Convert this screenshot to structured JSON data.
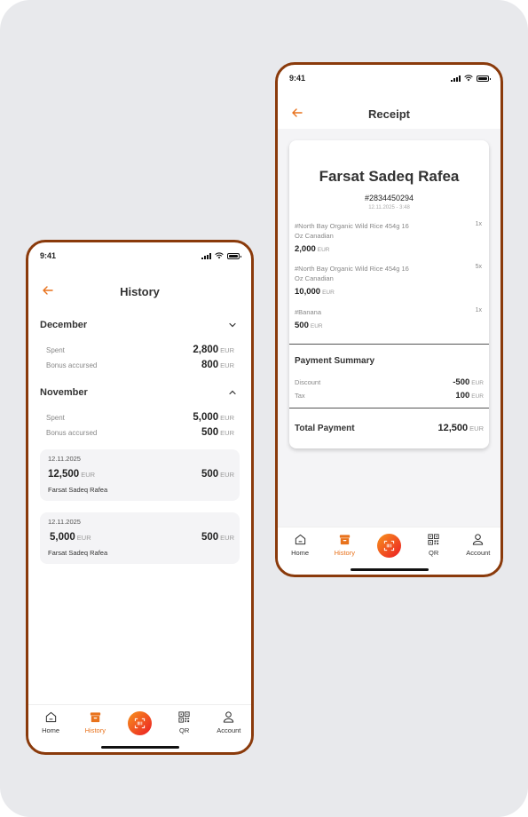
{
  "colors": {
    "accent": "#e8721c",
    "frame": "#8a3a0b",
    "scan_start": "#f7941d",
    "scan_end": "#ec1c24"
  },
  "history_screen": {
    "status_time": "9:41",
    "title": "History",
    "months": [
      {
        "name": "December",
        "expanded": false,
        "spent_label": "Spent",
        "spent_value": "2,800",
        "spent_currency": "EUR",
        "bonus_label": "Bonus accursed",
        "bonus_value": "800",
        "bonus_currency": "EUR"
      },
      {
        "name": "November",
        "expanded": true,
        "spent_label": "Spent",
        "spent_value": "5,000",
        "spent_currency": "EUR",
        "bonus_label": "Bonus accursed",
        "bonus_value": "500",
        "bonus_currency": "EUR",
        "transactions": [
          {
            "date": "12.11.2025",
            "amount": "12,500",
            "currency": "EUR",
            "bonus": "500",
            "bonus_currency": "EUR",
            "name": "Farsat Sadeq Rafea"
          },
          {
            "date": "12.11.2025",
            "amount": "5,000",
            "currency": "EUR",
            "bonus": "500",
            "bonus_currency": "EUR",
            "name": "Farsat Sadeq Rafea"
          }
        ]
      }
    ]
  },
  "receipt_screen": {
    "status_time": "9:41",
    "title": "Receipt",
    "customer_name": "Farsat Sadeq Rafea",
    "receipt_id": "#2834450294",
    "datetime": "12.11.2025 - 3:48",
    "items": [
      {
        "name": "#North Bay Organic Wild Rice 454g 16 Oz Canadian",
        "qty": "1x",
        "price": "2,000",
        "currency": "EUR"
      },
      {
        "name": "#North Bay Organic Wild Rice 454g 16 Oz Canadian",
        "qty": "5x",
        "price": "10,000",
        "currency": "EUR"
      },
      {
        "name": "#Banana",
        "qty": "1x",
        "price": "500",
        "currency": "EUR"
      }
    ],
    "summary_title": "Payment Summary",
    "discount_label": "Discount",
    "discount_value": "-500",
    "discount_currency": "EUR",
    "tax_label": "Tax",
    "tax_value": "100",
    "tax_currency": "EUR",
    "total_label": "Total Payment",
    "total_value": "12,500",
    "total_currency": "EUR"
  },
  "nav": {
    "items": [
      {
        "label": "Home",
        "icon": "home-icon"
      },
      {
        "label": "History",
        "icon": "archive-icon"
      },
      {
        "label": "",
        "icon": "scan-icon"
      },
      {
        "label": "QR",
        "icon": "qr-icon"
      },
      {
        "label": "Account",
        "icon": "user-icon"
      }
    ],
    "active": "History"
  }
}
